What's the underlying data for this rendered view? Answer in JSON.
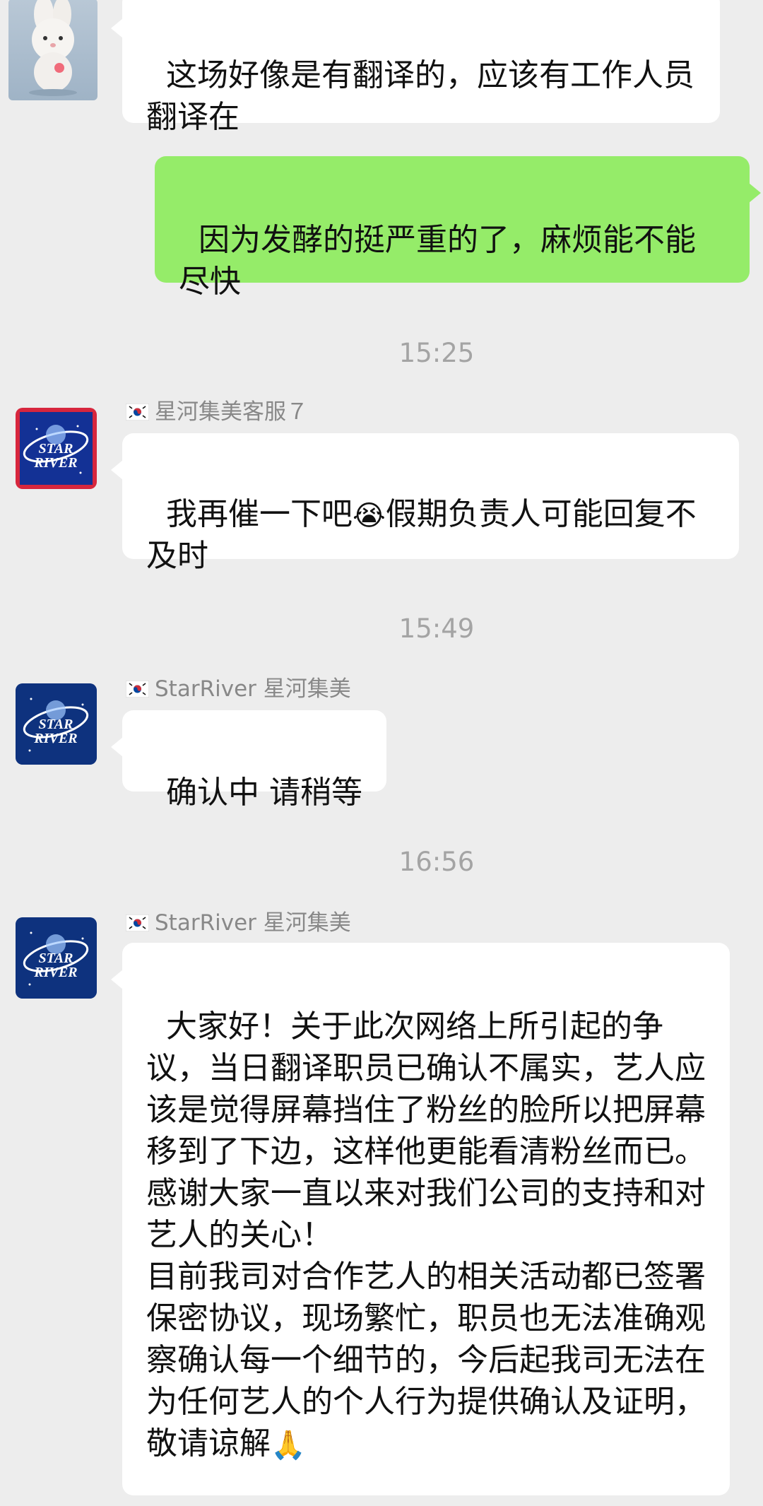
{
  "messages": [
    {
      "kind": "incoming",
      "avatar": "bunny-plush-avatar",
      "text": "这场好像是有翻译的，应该有工作人员翻译在"
    },
    {
      "kind": "outgoing",
      "text": "因为发酵的挺严重的了，麻烦能不能尽快"
    },
    {
      "kind": "time",
      "text": "15:25"
    },
    {
      "kind": "incoming",
      "avatar": "starriver-logo-avatar",
      "sender": "星河集美客服７",
      "text_before": "我再催一下吧",
      "emoji": "😭",
      "text_after": "假期负责人可能回复不及时"
    },
    {
      "kind": "time",
      "text": "15:49"
    },
    {
      "kind": "incoming",
      "avatar": "starriver-logo-avatar",
      "sender": "StarRiver 星河集美",
      "text": "确认中 请稍等"
    },
    {
      "kind": "time",
      "text": "16:56"
    },
    {
      "kind": "incoming",
      "avatar": "starriver-logo-avatar",
      "sender": "StarRiver 星河集美",
      "text": "大家好！关于此次网络上所引起的争议，当日翻译职员已确认不属实，艺人应该是觉得屏幕挡住了粉丝的脸所以把屏幕移到了下边，这样他更能看清粉丝而已。\n感谢大家一直以来对我们公司的支持和对艺人的关心！\n目前我司对合作艺人的相关活动都已签署保密协议，现场繁忙，职员也无法准确观察确认每一个细节的，今后起我司无法在为任何艺人的个人行为提供确认及证明，敬请谅解",
      "emoji": "🙏"
    }
  ],
  "colors": {
    "background": "#ededed",
    "incoming_bubble": "#ffffff",
    "outgoing_bubble": "#95ec69",
    "timestamp": "#a4a4a4",
    "sender": "#888888"
  },
  "icons": {
    "flag": "south-korea-flag-icon"
  }
}
